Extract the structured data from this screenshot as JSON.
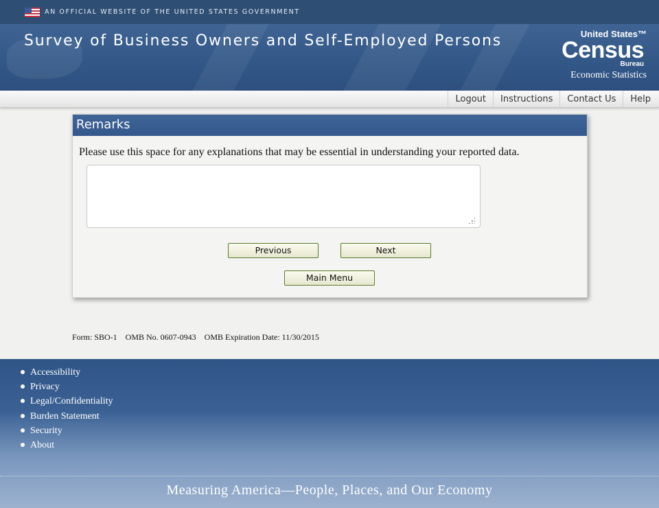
{
  "gov_banner": {
    "text": "AN OFFICIAL WEBSITE OF THE UNITED STATES GOVERNMENT",
    "flag_icon": "us-flag-icon"
  },
  "header": {
    "title": "Survey of Business Owners and Self-Employed Persons",
    "logo": {
      "line1": "United States™",
      "line2": "Census",
      "line3": "Bureau",
      "line4": "Economic Statistics"
    }
  },
  "nav": {
    "items": [
      "Logout",
      "Instructions",
      "Contact Us",
      "Help"
    ]
  },
  "remarks": {
    "heading": "Remarks",
    "instruction": "Please use this space for any explanations that may be essential in understanding your reported data.",
    "textarea_value": "",
    "buttons": {
      "previous": "Previous",
      "next": "Next",
      "main_menu": "Main Menu"
    }
  },
  "form_info": "Form: SBO-1    OMB No. 0607-0943    OMB Expiration Date: 11/30/2015",
  "footer": {
    "links": [
      "Accessibility",
      "Privacy",
      "Legal/Confidentiality",
      "Burden Statement",
      "Security",
      "About"
    ],
    "tagline": "Measuring America—People, Places, and Our Economy"
  },
  "colors": {
    "header_blue": "#335887",
    "panel_head": "#3a5e91",
    "button_border": "#5b7a2c"
  }
}
